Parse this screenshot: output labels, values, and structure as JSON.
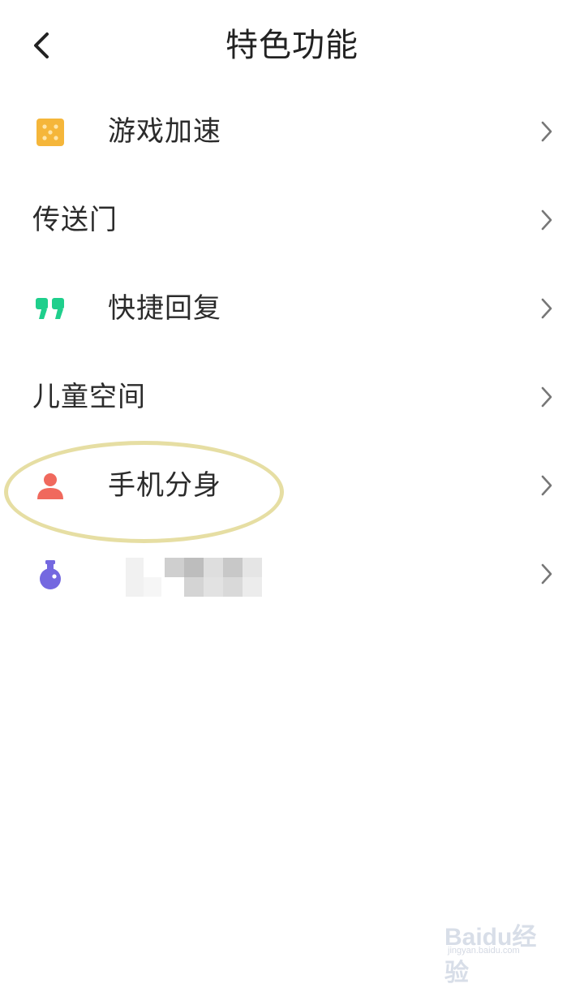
{
  "header": {
    "title": "特色功能",
    "back_icon": "back-arrow-icon"
  },
  "items": [
    {
      "label": "游戏加速",
      "icon": "game-accelerate-icon",
      "icon_color": "#f5b63a"
    },
    {
      "label": "传送门",
      "icon": null
    },
    {
      "label": "快捷回复",
      "icon": "quote-icon",
      "icon_color": "#1fcf8c"
    },
    {
      "label": "儿童空间",
      "icon": null
    },
    {
      "label": "手机分身",
      "icon": "person-icon",
      "icon_color": "#f0695d",
      "highlighted": true
    },
    {
      "label": "",
      "icon": "lab-flask-icon",
      "icon_color": "#7468e0",
      "label_obscured": true
    }
  ],
  "watermark": {
    "brand": "Baidu经验",
    "url": "jingyan.baidu.com"
  }
}
